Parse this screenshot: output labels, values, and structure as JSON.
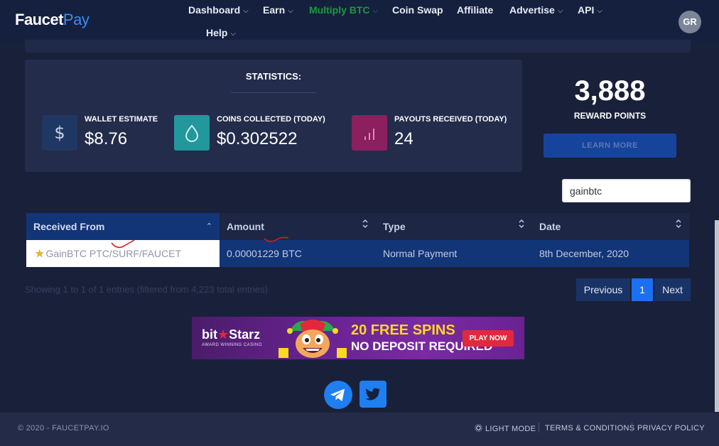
{
  "brand": {
    "part1": "Faucet",
    "part2": "Pay"
  },
  "nav": {
    "dashboard": "Dashboard",
    "earn": "Earn",
    "multiply": "Multiply BTC",
    "coinswap": "Coin Swap",
    "affiliate": "Affiliate",
    "advertise": "Advertise",
    "api": "API",
    "help": "Help",
    "chevron": "⌵"
  },
  "user": {
    "initials": "GR"
  },
  "stats": {
    "title": "STATISTICS:",
    "wallet": {
      "label": "WALLET ESTIMATE",
      "value": "$8.76",
      "icon": "dollar-icon",
      "color": "#1f3863"
    },
    "coins": {
      "label": "COINS COLLECTED (TODAY)",
      "value": "$0.302522",
      "icon": "droplet-icon",
      "color": "#22979c"
    },
    "payouts": {
      "label": "PAYOUTS RECEIVED (TODAY)",
      "value": "24",
      "icon": "bar-chart-icon",
      "color": "#8c1f5e"
    }
  },
  "reward": {
    "points": "3,888",
    "label": "REWARD POINTS",
    "button": "LEARN MORE"
  },
  "search": {
    "value": "gainbtc"
  },
  "table": {
    "headers": {
      "from": "Received From",
      "amount": "Amount",
      "type": "Type",
      "date": "Date"
    },
    "rows": [
      {
        "from": "GainBTC PTC/SURF/FAUCET",
        "amount": "0.00001229 BTC",
        "type": "Normal Payment",
        "date": "8th December, 2020"
      }
    ],
    "info": "Showing 1 to 1 of 1 entries (filtered from 4,223 total entries)"
  },
  "pager": {
    "previous": "Previous",
    "current": "1",
    "next": "Next"
  },
  "ad": {
    "brand1": "bit",
    "brand_star": "★",
    "brand2": "Starz",
    "tagline": "AWARD WINNING CASINO",
    "line1": "20 FREE SPINS",
    "line2": "NO DEPOSIT REQUIRED",
    "button": "PLAY NOW"
  },
  "social": {
    "telegram": "telegram-icon",
    "twitter": "twitter-icon"
  },
  "footer": {
    "copyright": "© 2020 - FAUCETPAY.IO",
    "light_mode": "LIGHT MODE",
    "terms": "TERMS & CONDITIONS",
    "privacy": "PRIVACY POLICY"
  }
}
